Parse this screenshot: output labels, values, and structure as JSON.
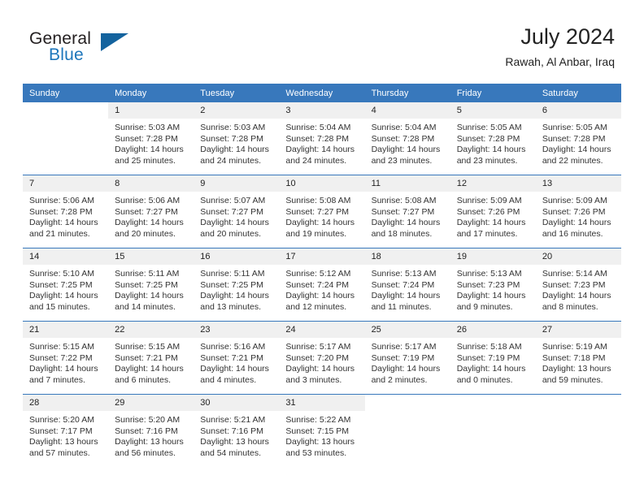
{
  "brand": {
    "word1": "General",
    "word2": "Blue",
    "logo_color": "#14639e",
    "blue_text_color": "#1d76bb"
  },
  "header": {
    "title": "July 2024",
    "location": "Rawah, Al Anbar, Iraq"
  },
  "theme": {
    "header_row_bg": "#3878bc",
    "daynum_bg": "#f0f0f0",
    "row_divider": "#3878bc",
    "text": "#222222"
  },
  "weekday_headers": [
    "Sunday",
    "Monday",
    "Tuesday",
    "Wednesday",
    "Thursday",
    "Friday",
    "Saturday"
  ],
  "labels": {
    "sunrise_prefix": "Sunrise:",
    "sunset_prefix": "Sunset:",
    "daylight_prefix": "Daylight:"
  },
  "weeks": [
    [
      {
        "day": "",
        "blank": true
      },
      {
        "day": "1",
        "sunrise": "Sunrise: 5:03 AM",
        "sunset": "Sunset: 7:28 PM",
        "daylight1": "Daylight: 14 hours",
        "daylight2": "and 25 minutes."
      },
      {
        "day": "2",
        "sunrise": "Sunrise: 5:03 AM",
        "sunset": "Sunset: 7:28 PM",
        "daylight1": "Daylight: 14 hours",
        "daylight2": "and 24 minutes."
      },
      {
        "day": "3",
        "sunrise": "Sunrise: 5:04 AM",
        "sunset": "Sunset: 7:28 PM",
        "daylight1": "Daylight: 14 hours",
        "daylight2": "and 24 minutes."
      },
      {
        "day": "4",
        "sunrise": "Sunrise: 5:04 AM",
        "sunset": "Sunset: 7:28 PM",
        "daylight1": "Daylight: 14 hours",
        "daylight2": "and 23 minutes."
      },
      {
        "day": "5",
        "sunrise": "Sunrise: 5:05 AM",
        "sunset": "Sunset: 7:28 PM",
        "daylight1": "Daylight: 14 hours",
        "daylight2": "and 23 minutes."
      },
      {
        "day": "6",
        "sunrise": "Sunrise: 5:05 AM",
        "sunset": "Sunset: 7:28 PM",
        "daylight1": "Daylight: 14 hours",
        "daylight2": "and 22 minutes."
      }
    ],
    [
      {
        "day": "7",
        "sunrise": "Sunrise: 5:06 AM",
        "sunset": "Sunset: 7:28 PM",
        "daylight1": "Daylight: 14 hours",
        "daylight2": "and 21 minutes."
      },
      {
        "day": "8",
        "sunrise": "Sunrise: 5:06 AM",
        "sunset": "Sunset: 7:27 PM",
        "daylight1": "Daylight: 14 hours",
        "daylight2": "and 20 minutes."
      },
      {
        "day": "9",
        "sunrise": "Sunrise: 5:07 AM",
        "sunset": "Sunset: 7:27 PM",
        "daylight1": "Daylight: 14 hours",
        "daylight2": "and 20 minutes."
      },
      {
        "day": "10",
        "sunrise": "Sunrise: 5:08 AM",
        "sunset": "Sunset: 7:27 PM",
        "daylight1": "Daylight: 14 hours",
        "daylight2": "and 19 minutes."
      },
      {
        "day": "11",
        "sunrise": "Sunrise: 5:08 AM",
        "sunset": "Sunset: 7:27 PM",
        "daylight1": "Daylight: 14 hours",
        "daylight2": "and 18 minutes."
      },
      {
        "day": "12",
        "sunrise": "Sunrise: 5:09 AM",
        "sunset": "Sunset: 7:26 PM",
        "daylight1": "Daylight: 14 hours",
        "daylight2": "and 17 minutes."
      },
      {
        "day": "13",
        "sunrise": "Sunrise: 5:09 AM",
        "sunset": "Sunset: 7:26 PM",
        "daylight1": "Daylight: 14 hours",
        "daylight2": "and 16 minutes."
      }
    ],
    [
      {
        "day": "14",
        "sunrise": "Sunrise: 5:10 AM",
        "sunset": "Sunset: 7:25 PM",
        "daylight1": "Daylight: 14 hours",
        "daylight2": "and 15 minutes."
      },
      {
        "day": "15",
        "sunrise": "Sunrise: 5:11 AM",
        "sunset": "Sunset: 7:25 PM",
        "daylight1": "Daylight: 14 hours",
        "daylight2": "and 14 minutes."
      },
      {
        "day": "16",
        "sunrise": "Sunrise: 5:11 AM",
        "sunset": "Sunset: 7:25 PM",
        "daylight1": "Daylight: 14 hours",
        "daylight2": "and 13 minutes."
      },
      {
        "day": "17",
        "sunrise": "Sunrise: 5:12 AM",
        "sunset": "Sunset: 7:24 PM",
        "daylight1": "Daylight: 14 hours",
        "daylight2": "and 12 minutes."
      },
      {
        "day": "18",
        "sunrise": "Sunrise: 5:13 AM",
        "sunset": "Sunset: 7:24 PM",
        "daylight1": "Daylight: 14 hours",
        "daylight2": "and 11 minutes."
      },
      {
        "day": "19",
        "sunrise": "Sunrise: 5:13 AM",
        "sunset": "Sunset: 7:23 PM",
        "daylight1": "Daylight: 14 hours",
        "daylight2": "and 9 minutes."
      },
      {
        "day": "20",
        "sunrise": "Sunrise: 5:14 AM",
        "sunset": "Sunset: 7:23 PM",
        "daylight1": "Daylight: 14 hours",
        "daylight2": "and 8 minutes."
      }
    ],
    [
      {
        "day": "21",
        "sunrise": "Sunrise: 5:15 AM",
        "sunset": "Sunset: 7:22 PM",
        "daylight1": "Daylight: 14 hours",
        "daylight2": "and 7 minutes."
      },
      {
        "day": "22",
        "sunrise": "Sunrise: 5:15 AM",
        "sunset": "Sunset: 7:21 PM",
        "daylight1": "Daylight: 14 hours",
        "daylight2": "and 6 minutes."
      },
      {
        "day": "23",
        "sunrise": "Sunrise: 5:16 AM",
        "sunset": "Sunset: 7:21 PM",
        "daylight1": "Daylight: 14 hours",
        "daylight2": "and 4 minutes."
      },
      {
        "day": "24",
        "sunrise": "Sunrise: 5:17 AM",
        "sunset": "Sunset: 7:20 PM",
        "daylight1": "Daylight: 14 hours",
        "daylight2": "and 3 minutes."
      },
      {
        "day": "25",
        "sunrise": "Sunrise: 5:17 AM",
        "sunset": "Sunset: 7:19 PM",
        "daylight1": "Daylight: 14 hours",
        "daylight2": "and 2 minutes."
      },
      {
        "day": "26",
        "sunrise": "Sunrise: 5:18 AM",
        "sunset": "Sunset: 7:19 PM",
        "daylight1": "Daylight: 14 hours",
        "daylight2": "and 0 minutes."
      },
      {
        "day": "27",
        "sunrise": "Sunrise: 5:19 AM",
        "sunset": "Sunset: 7:18 PM",
        "daylight1": "Daylight: 13 hours",
        "daylight2": "and 59 minutes."
      }
    ],
    [
      {
        "day": "28",
        "sunrise": "Sunrise: 5:20 AM",
        "sunset": "Sunset: 7:17 PM",
        "daylight1": "Daylight: 13 hours",
        "daylight2": "and 57 minutes."
      },
      {
        "day": "29",
        "sunrise": "Sunrise: 5:20 AM",
        "sunset": "Sunset: 7:16 PM",
        "daylight1": "Daylight: 13 hours",
        "daylight2": "and 56 minutes."
      },
      {
        "day": "30",
        "sunrise": "Sunrise: 5:21 AM",
        "sunset": "Sunset: 7:16 PM",
        "daylight1": "Daylight: 13 hours",
        "daylight2": "and 54 minutes."
      },
      {
        "day": "31",
        "sunrise": "Sunrise: 5:22 AM",
        "sunset": "Sunset: 7:15 PM",
        "daylight1": "Daylight: 13 hours",
        "daylight2": "and 53 minutes."
      },
      {
        "day": "",
        "blank": true
      },
      {
        "day": "",
        "blank": true
      },
      {
        "day": "",
        "blank": true
      }
    ]
  ]
}
